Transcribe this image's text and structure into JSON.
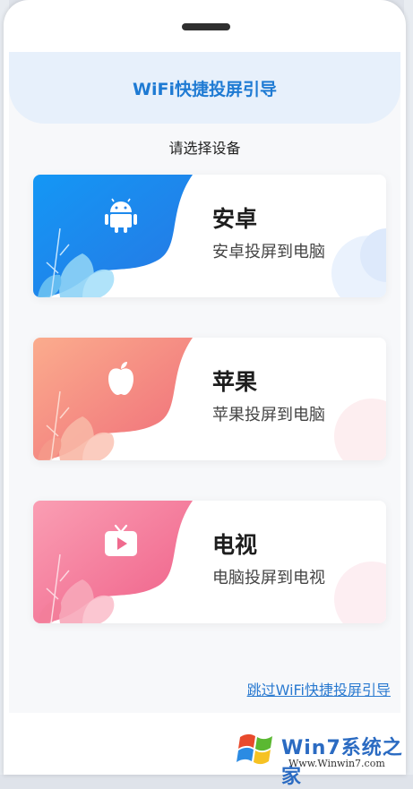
{
  "header": {
    "title": "WiFi快捷投屏引导"
  },
  "subtitle": "请选择设备",
  "cards": [
    {
      "title": "安卓",
      "desc": "安卓投屏到电脑",
      "icon": "android-icon",
      "color_from": "#1a8cf0",
      "color_to": "#2c7fe6"
    },
    {
      "title": "苹果",
      "desc": "苹果投屏到电脑",
      "icon": "apple-icon",
      "color_from": "#f9a98c",
      "color_to": "#f06f7a"
    },
    {
      "title": "电视",
      "desc": "电脑投屏到电视",
      "icon": "tv-icon",
      "color_from": "#f99aaf",
      "color_to": "#f0608a"
    }
  ],
  "skip_link": "跳过WiFi快捷投屏引导",
  "watermark": {
    "brand": "Win7系统之家",
    "url": "Www.Winwin7.com"
  }
}
